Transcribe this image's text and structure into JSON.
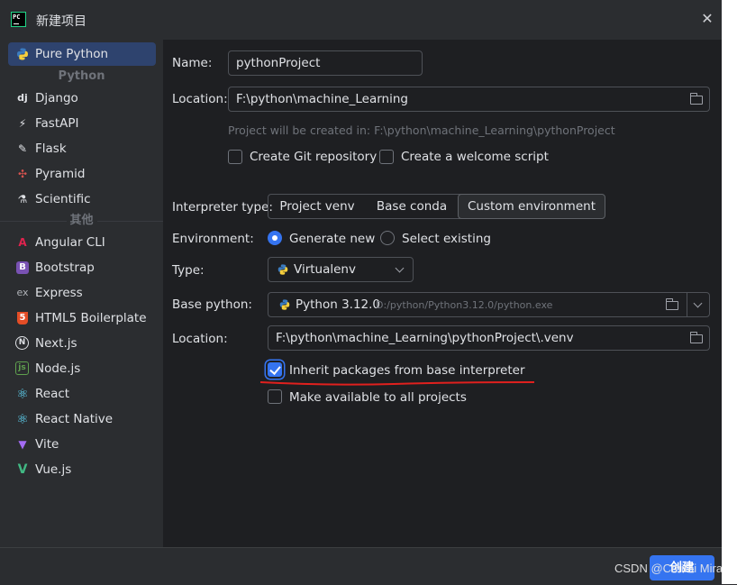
{
  "window": {
    "title": "新建项目",
    "close_label": "✕"
  },
  "app_logo": {
    "text": "PC"
  },
  "sidebar": {
    "selected": {
      "label": "Pure Python",
      "icon": "python-icon"
    },
    "group_python": "Python",
    "python_items": [
      {
        "label": "Django",
        "icon": "django-icon",
        "glyph": "dj"
      },
      {
        "label": "FastAPI",
        "icon": "fastapi-icon",
        "glyph": "⚡"
      },
      {
        "label": "Flask",
        "icon": "flask-icon",
        "glyph": "✎"
      },
      {
        "label": "Pyramid",
        "icon": "pyramid-icon",
        "glyph": "✣"
      },
      {
        "label": "Scientific",
        "icon": "scientific-icon",
        "glyph": "⚗"
      }
    ],
    "group_other": "其他",
    "other_items": [
      {
        "label": "Angular CLI",
        "icon": "angular-icon",
        "glyph": "A"
      },
      {
        "label": "Bootstrap",
        "icon": "bootstrap-icon",
        "glyph": "B"
      },
      {
        "label": "Express",
        "icon": "express-icon",
        "glyph": "ex"
      },
      {
        "label": "HTML5 Boilerplate",
        "icon": "html5-icon",
        "glyph": "5"
      },
      {
        "label": "Next.js",
        "icon": "nextjs-icon",
        "glyph": "N"
      },
      {
        "label": "Node.js",
        "icon": "nodejs-icon",
        "glyph": "js"
      },
      {
        "label": "React",
        "icon": "react-icon",
        "glyph": "⚛"
      },
      {
        "label": "React Native",
        "icon": "react-native-icon",
        "glyph": "⚛"
      },
      {
        "label": "Vite",
        "icon": "vite-icon",
        "glyph": "▼"
      },
      {
        "label": "Vue.js",
        "icon": "vue-icon",
        "glyph": "V"
      }
    ]
  },
  "form": {
    "name_label": "Name:",
    "name_value": "pythonProject",
    "location_label": "Location:",
    "location_value": "F:\\python\\machine_Learning",
    "location_hint": "Project will be created in: F:\\python\\machine_Learning\\pythonProject",
    "create_git_label": "Create Git repository",
    "create_git_checked": false,
    "welcome_script_label": "Create a welcome script",
    "welcome_script_checked": false,
    "interpreter_type_label": "Interpreter type:",
    "interpreter_tabs": [
      "Project venv",
      "Base conda",
      "Custom environment"
    ],
    "interpreter_active": "Custom environment",
    "environment_label": "Environment:",
    "env_generate": "Generate new",
    "env_select": "Select existing",
    "env_selected": "Generate new",
    "type_label": "Type:",
    "type_value": "Virtualenv",
    "base_python_label": "Base python:",
    "base_python_version": "Python 3.12.0",
    "base_python_path": "D:/python/Python3.12.0/python.exe",
    "venv_location_label": "Location:",
    "venv_location_value": "F:\\python\\machine_Learning\\pythonProject\\.venv",
    "inherit_label": "Inherit packages from base interpreter",
    "inherit_checked": true,
    "make_available_label": "Make available to all projects",
    "make_available_checked": false
  },
  "footer": {
    "create_label": "创建",
    "watermark": "CSDN @Cmirai Mirai"
  },
  "colors": {
    "accent": "#3574f0",
    "annotation": "#e0201e",
    "selected_bg": "#2e436e"
  }
}
